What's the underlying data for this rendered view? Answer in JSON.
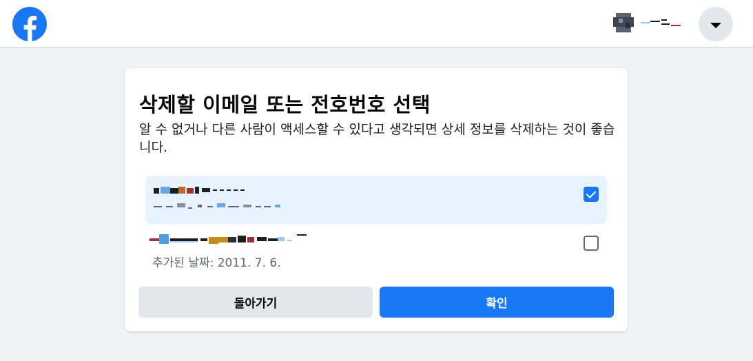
{
  "header": {
    "logo_icon": "facebook-logo-icon",
    "menu_icon": "caret-down-icon",
    "profile": {
      "avatar_icon": "avatar-pixelated",
      "name": ""
    }
  },
  "dialog": {
    "title": "삭제할 이메일 또는 전호번호 선택",
    "description": "알 수 없거나 다른 사람이 액세스할 수 있다고 생각되면 상세 정보를 삭제하는 것이 좋습니다.",
    "items": [
      {
        "contact": "",
        "subtext": "",
        "checked": true
      },
      {
        "contact": "",
        "added_date": "추가된 날짜: 2011. 7. 6.",
        "checked": false
      }
    ],
    "buttons": {
      "back": "돌아가기",
      "confirm": "확인"
    }
  },
  "colors": {
    "brand": "#1877f2",
    "page_bg": "#f0f2f5",
    "selected_bg": "#e7f3ff",
    "secondary_button": "#e4e6eb"
  }
}
